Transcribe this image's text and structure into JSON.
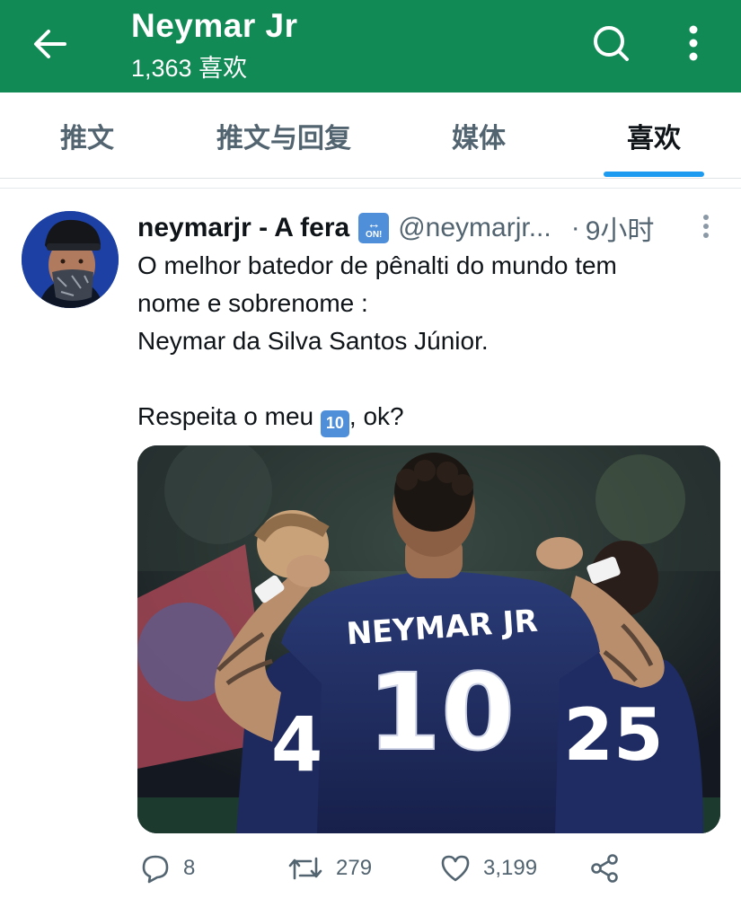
{
  "header": {
    "title": "Neymar Jr",
    "subtitle": "1,363 喜欢",
    "bg_color": "#128a56",
    "icons": {
      "back": "arrow-left-icon",
      "search": "search-icon",
      "more": "more-vertical-icon"
    }
  },
  "tabs": [
    {
      "label": "推文",
      "active": false
    },
    {
      "label": "推文与回复",
      "active": false
    },
    {
      "label": "媒体",
      "active": false
    },
    {
      "label": "喜欢",
      "active": true
    }
  ],
  "tweet": {
    "author_name": "neymarjr - A fera",
    "badge_text": "ON!",
    "handle": "@neymarjr...",
    "separator": "·",
    "time": "9小时",
    "text_lines": [
      "O melhor batedor de pênalti do mundo tem",
      "nome e sobrenome :",
      "Neymar da Silva Santos Júnior."
    ],
    "text_last_before": "Respeita o meu ",
    "ten_badge": "10",
    "text_last_after": ", ok?",
    "image": {
      "main_jersey_name": "NEYMAR JR",
      "main_number": "10",
      "left_number": "4",
      "right_number": "25"
    },
    "actions": {
      "reply_count": "8",
      "retweet_count": "279",
      "like_count": "3,199"
    }
  },
  "colors": {
    "accent": "#1d9bf0",
    "muted": "#536471",
    "text": "#0f1419"
  }
}
